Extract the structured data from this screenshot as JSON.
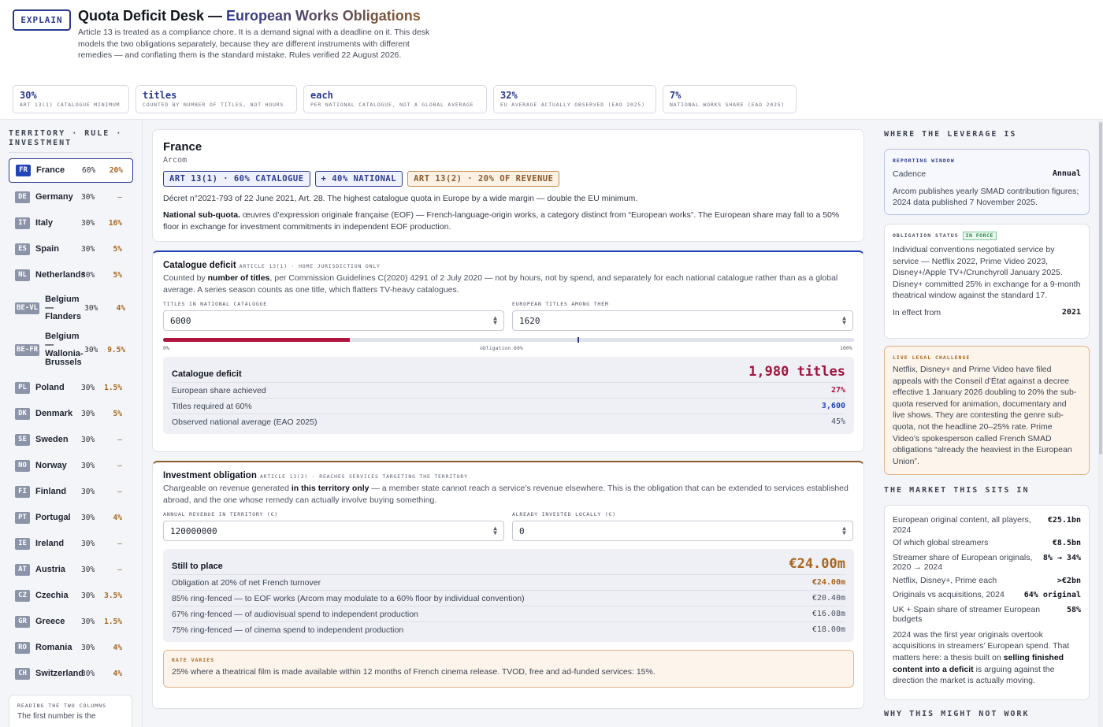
{
  "header": {
    "explain_label": "EXPLAIN",
    "title_main": "Quota Deficit Desk — ",
    "title_accent": "European Works Obligations",
    "intro": "Article 13 is treated as a compliance chore. It is a demand signal with a deadline on it. This desk models the two obligations separately, because they are different instruments with different remedies — and conflating them is the standard mistake. Rules verified 22 August 2026.",
    "stats": [
      {
        "value": "30%",
        "label": "ART 13(1) CATALOGUE MINIMUM"
      },
      {
        "value": "titles",
        "label": "COUNTED BY NUMBER OF TITLES, NOT HOURS"
      },
      {
        "value": "each",
        "label": "PER NATIONAL CATALOGUE, NOT A GLOBAL AVERAGE"
      },
      {
        "value": "32%",
        "label": "EU AVERAGE ACTUALLY OBSERVED (EAO 2025)"
      },
      {
        "value": "7%",
        "label": "NATIONAL WORKS SHARE (EAO 2025)"
      }
    ]
  },
  "sidebar": {
    "heading": "TERRITORY · RULE · INVESTMENT",
    "territories": [
      {
        "code": "FR",
        "name": "France",
        "catalogue": "60%",
        "investment": "20%"
      },
      {
        "code": "DE",
        "name": "Germany",
        "catalogue": "30%",
        "investment": "—"
      },
      {
        "code": "IT",
        "name": "Italy",
        "catalogue": "30%",
        "investment": "16%"
      },
      {
        "code": "ES",
        "name": "Spain",
        "catalogue": "30%",
        "investment": "5%"
      },
      {
        "code": "NL",
        "name": "Netherlands",
        "catalogue": "30%",
        "investment": "5%"
      },
      {
        "code": "BE-VL",
        "name": "Belgium — Flanders",
        "catalogue": "30%",
        "investment": "4%"
      },
      {
        "code": "BE-FR",
        "name": "Belgium — Wallonia-Brussels",
        "catalogue": "30%",
        "investment": "9.5%"
      },
      {
        "code": "PL",
        "name": "Poland",
        "catalogue": "30%",
        "investment": "1.5%"
      },
      {
        "code": "DK",
        "name": "Denmark",
        "catalogue": "30%",
        "investment": "5%"
      },
      {
        "code": "SE",
        "name": "Sweden",
        "catalogue": "30%",
        "investment": "—"
      },
      {
        "code": "NO",
        "name": "Norway",
        "catalogue": "30%",
        "investment": "—"
      },
      {
        "code": "FI",
        "name": "Finland",
        "catalogue": "30%",
        "investment": "—"
      },
      {
        "code": "PT",
        "name": "Portugal",
        "catalogue": "30%",
        "investment": "4%"
      },
      {
        "code": "IE",
        "name": "Ireland",
        "catalogue": "30%",
        "investment": "—"
      },
      {
        "code": "AT",
        "name": "Austria",
        "catalogue": "30%",
        "investment": "—"
      },
      {
        "code": "CZ",
        "name": "Czechia",
        "catalogue": "30%",
        "investment": "3.5%"
      },
      {
        "code": "GR",
        "name": "Greece",
        "catalogue": "30%",
        "investment": "1.5%"
      },
      {
        "code": "RO",
        "name": "Romania",
        "catalogue": "30%",
        "investment": "4%"
      },
      {
        "code": "CH",
        "name": "Switzerland",
        "catalogue": "30%",
        "investment": "4%"
      }
    ],
    "reading": {
      "heading": "READING THE TWO COLUMNS",
      "body": "The first number is the"
    }
  },
  "france": {
    "name": "France",
    "regulator": "Arcom",
    "chips": [
      "ART 13(1) · 60% CATALOGUE",
      "+ 40% NATIONAL",
      "ART 13(2) · 20% OF REVENUE"
    ],
    "decree": "Décret n°2021-793 of 22 June 2021, Art. 28. The highest catalogue quota in Europe by a wide margin — double the EU minimum.",
    "subquota_label": "National sub-quota.",
    "subquota_text": " œuvres d’expression originale française (EOF) — French-language-origin works, a category distinct from “European works”. The European share may fall to a 50% floor in exchange for investment commitments in independent EOF production."
  },
  "catalogue": {
    "title": "Catalogue deficit",
    "tag": "ARTICLE 13(1) · HOME JURISDICTION ONLY",
    "desc_pre": "Counted by ",
    "desc_bold": "number of titles",
    "desc_post": ", per Commission Guidelines C(2020) 4291 of 2 July 2020 — not by hours, not by spend, and separately for each national catalogue rather than as a global average. A series season counts as one title, which flatters TV-heavy catalogues.",
    "field1_label": "TITLES IN NATIONAL CATALOGUE",
    "field1_value": "6000",
    "field2_label": "EUROPEAN TITLES AMONG THEM",
    "field2_value": "1620",
    "bar_fill": 0.27,
    "bar_obligation": 0.6,
    "bar_min_label": "0%",
    "bar_mid_label": "obligation 60%",
    "bar_max_label": "100%",
    "result_label": "Catalogue deficit",
    "result_value": "1,980 titles",
    "rows": [
      {
        "label": "European share achieved",
        "value": "27%"
      },
      {
        "label": "Titles required at 60%",
        "value": "3,600"
      },
      {
        "label": "Observed national average (EAO 2025)",
        "value": "45%"
      }
    ]
  },
  "investment": {
    "title": "Investment obligation",
    "tag": "ARTICLE 13(2) · REACHES SERVICES TARGETING THE TERRITORY",
    "desc_pre": "Chargeable on revenue generated ",
    "desc_bold": "in this territory only",
    "desc_post": " — a member state cannot reach a service’s revenue elsewhere. This is the obligation that can be extended to services established abroad, and the one whose remedy can actually involve buying something.",
    "field1_label": "ANNUAL REVENUE IN TERRITORY (€)",
    "field1_value": "120000000",
    "field2_label": "ALREADY INVESTED LOCALLY (€)",
    "field2_value": "0",
    "result_label": "Still to place",
    "result_value": "€24.00m",
    "rows": [
      {
        "label": "Obligation at 20% of net French turnover",
        "value": "€24.00m"
      },
      {
        "label": "85% ring-fenced — to EOF works (Arcom may modulate to a 60% floor by individual convention)",
        "value": "€20.40m"
      },
      {
        "label": "67% ring-fenced — of audiovisual spend to independent production",
        "value": "€16.08m"
      },
      {
        "label": "75% ring-fenced — of cinema spend to independent production",
        "value": "€18.00m"
      }
    ],
    "rate_heading": "RATE VARIES",
    "rate_body": "25% where a theatrical film is made available within 12 months of French cinema release. TVOD, free and ad-funded services: 15%."
  },
  "right": {
    "leverage_heading": "WHERE THE LEVERAGE IS",
    "reporting": {
      "heading": "REPORTING WINDOW",
      "key": "Cadence",
      "value": "Annual",
      "body": "Arcom publishes yearly SMAD contribution figures; 2024 data published 7 November 2025."
    },
    "status": {
      "heading": "OBLIGATION STATUS",
      "badge": "IN FORCE",
      "body": "Individual conventions negotiated service by service — Netflix 2022, Prime Video 2023, Disney+/Apple TV+/Crunchyroll January 2025. Disney+ committed 25% in exchange for a 9-month theatrical window against the standard 17.",
      "key": "In effect from",
      "value": "2021"
    },
    "challenge": {
      "heading": "LIVE LEGAL CHALLENGE",
      "body": "Netflix, Disney+ and Prime Video have filed appeals with the Conseil d’État against a decree effective 1 January 2026 doubling to 20% the sub-quota reserved for animation, documentary and live shows. They are contesting the genre sub-quota, not the headline 20–25% rate. Prime Video’s spokesperson called French SMAD obligations “already the heaviest in the European Union”."
    },
    "market_heading": "THE MARKET THIS SITS IN",
    "market_rows": [
      {
        "label": "European original content, all players, 2024",
        "value": "€25.1bn"
      },
      {
        "label": "Of which global streamers",
        "value": "€8.5bn"
      },
      {
        "label": "Streamer share of European originals, 2020 → 2024",
        "value": "8% → 34%"
      },
      {
        "label": "Netflix, Disney+, Prime each",
        "value": ">€2bn"
      },
      {
        "label": "Originals vs acquisitions, 2024",
        "value": "64% original"
      },
      {
        "label": "UK + Spain share of streamer European budgets",
        "value": "58%"
      }
    ],
    "market_note_pre": "2024 was the first year originals overtook acquisitions in streamers’ European spend. That matters here: a thesis built on ",
    "market_note_bold": "selling finished content into a deficit",
    "market_note_post": " is arguing against the direction the market is actually moving.",
    "why_heading": "WHY THIS MIGHT NOT WORK"
  }
}
